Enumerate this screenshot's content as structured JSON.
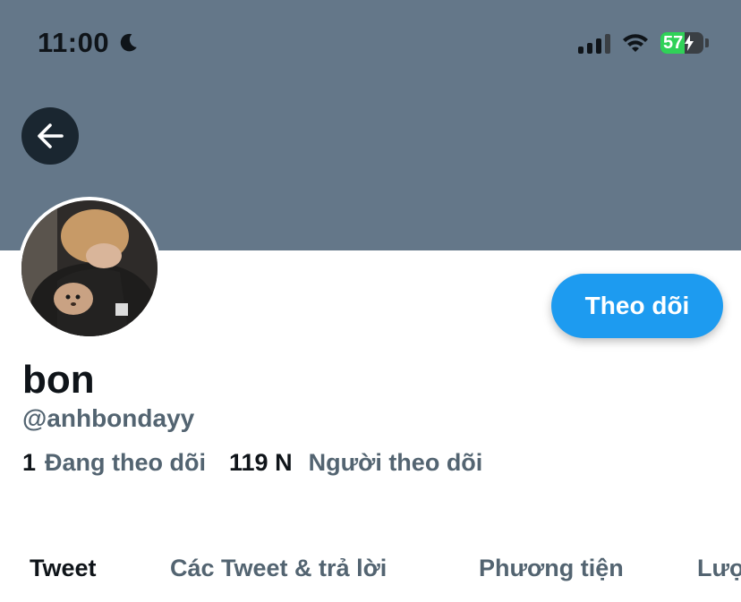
{
  "status_bar": {
    "time": "11:00",
    "battery": "57",
    "battery_level": 0.57
  },
  "icons": {
    "moon": "moon-icon",
    "signal": "cellular-signal-icon",
    "wifi": "wifi-icon",
    "battery": "battery-charging-icon",
    "back": "arrow-left-icon"
  },
  "colors": {
    "banner": "#647789",
    "follow_button": "#1d9bf0",
    "secondary_text": "#536471",
    "primary_text": "#0f1419"
  },
  "profile": {
    "display_name": "bon",
    "handle": "@anhbondayy",
    "follow_label": "Theo dõi",
    "following_count": "1",
    "following_label": "Đang theo dõi",
    "followers_count": "119 N",
    "followers_label": "Người theo dõi"
  },
  "tabs": [
    {
      "label": "Tweet",
      "active": true
    },
    {
      "label": "Các Tweet & trả lời",
      "active": false
    },
    {
      "label": "Phương tiện",
      "active": false
    },
    {
      "label": "Lượ",
      "active": false
    }
  ]
}
